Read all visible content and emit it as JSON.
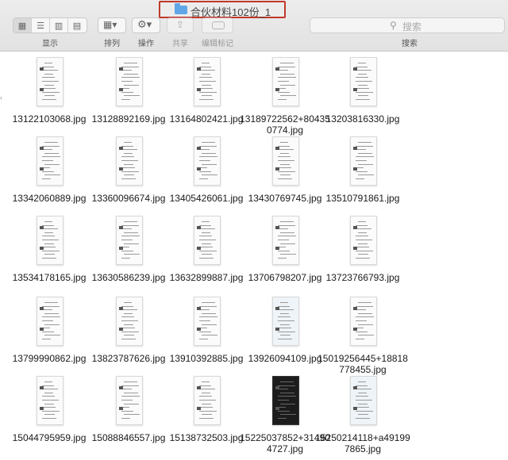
{
  "window": {
    "title": "合伙材料102份_1"
  },
  "toolbar": {
    "view_label": "显示",
    "arrange_label": "排列",
    "action_label": "操作",
    "share_label": "共享",
    "tags_label": "编辑标记",
    "search_label": "搜索",
    "search_placeholder": "搜索"
  },
  "files": [
    {
      "name": "13122103068.jpg",
      "variant": "plain"
    },
    {
      "name": "13128892169.jpg",
      "variant": "plain"
    },
    {
      "name": "13164802421.jpg",
      "variant": "plain"
    },
    {
      "name": "13189722562+804350774.jpg",
      "variant": "plain"
    },
    {
      "name": "13203816330.jpg",
      "variant": "plain"
    },
    {
      "name": "13342060889.jpg",
      "variant": "plain"
    },
    {
      "name": "13360096674.jpg",
      "variant": "plain"
    },
    {
      "name": "13405426061.jpg",
      "variant": "plain"
    },
    {
      "name": "13430769745.jpg",
      "variant": "plain"
    },
    {
      "name": "13510791861.jpg",
      "variant": "plain"
    },
    {
      "name": "13534178165.jpg",
      "variant": "plain"
    },
    {
      "name": "13630586239.jpg",
      "variant": "plain"
    },
    {
      "name": "13632899887.jpg",
      "variant": "plain"
    },
    {
      "name": "13706798207.jpg",
      "variant": "plain"
    },
    {
      "name": "13723766793.jpg",
      "variant": "plain"
    },
    {
      "name": "13799990862.jpg",
      "variant": "plain"
    },
    {
      "name": "13823787626.jpg",
      "variant": "plain"
    },
    {
      "name": "13910392885.jpg",
      "variant": "plain"
    },
    {
      "name": "13926094109.jpg",
      "variant": "blue"
    },
    {
      "name": "15019256445+18818778455.jpg",
      "variant": "plain"
    },
    {
      "name": "15044795959.jpg",
      "variant": "plain"
    },
    {
      "name": "15088846557.jpg",
      "variant": "plain"
    },
    {
      "name": "15138732503.jpg",
      "variant": "plain"
    },
    {
      "name": "15225037852+314904727.jpg",
      "variant": "dark"
    },
    {
      "name": "15250214118+a491997865.jpg",
      "variant": "blue"
    }
  ]
}
